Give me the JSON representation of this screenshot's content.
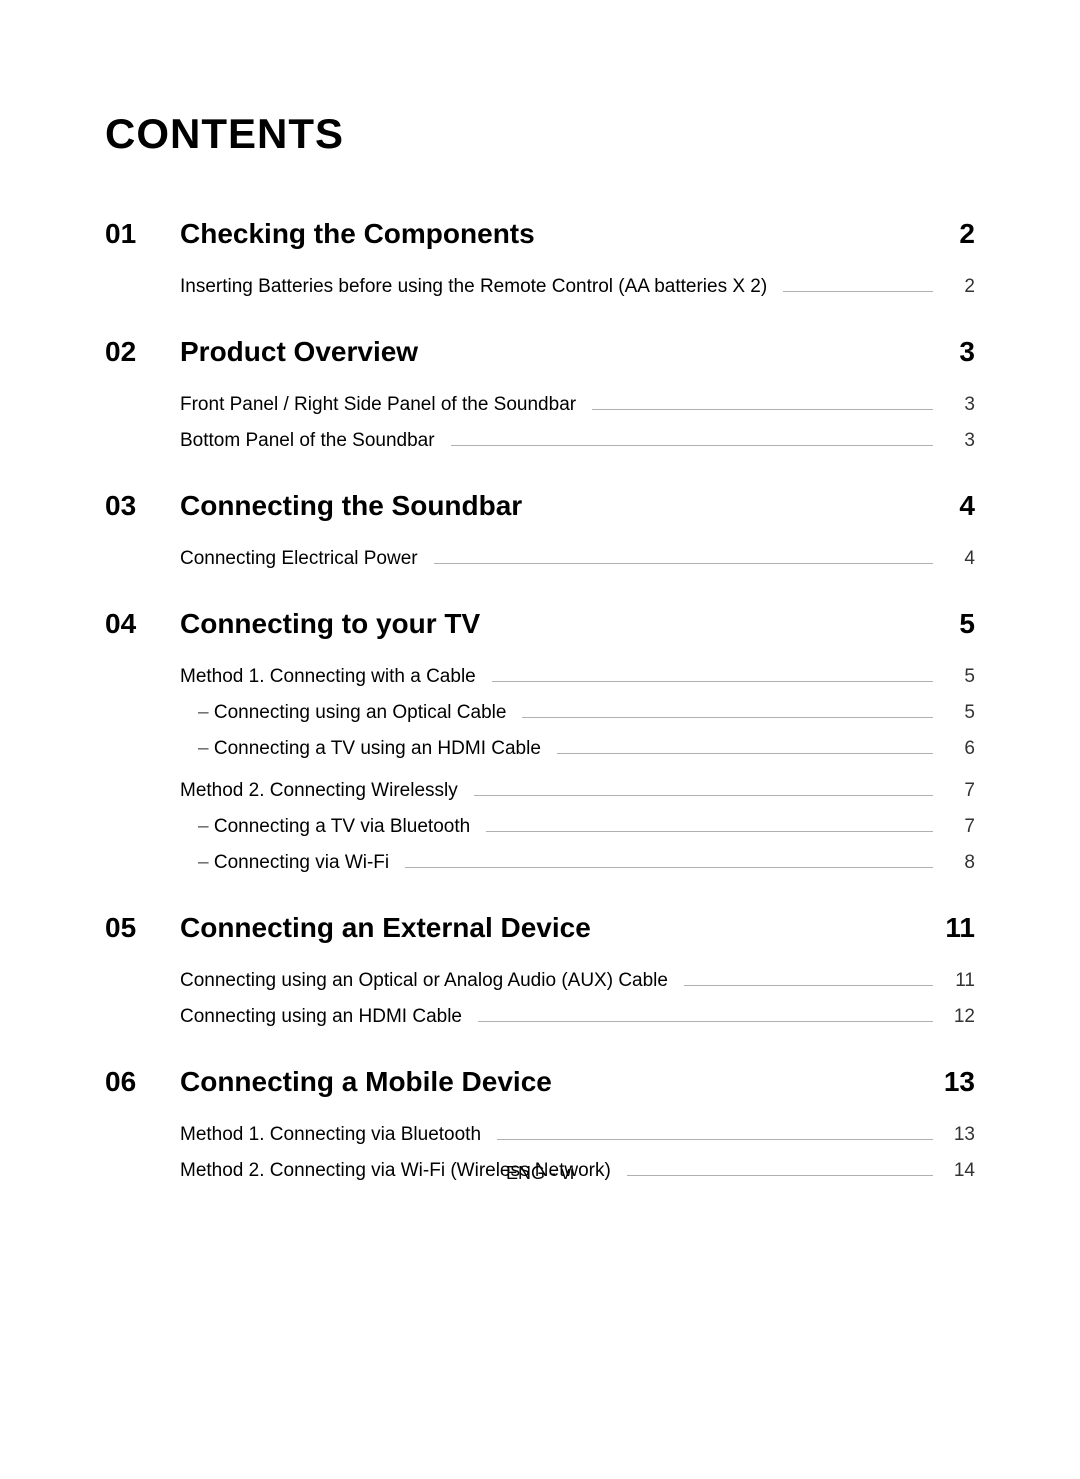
{
  "title": "CONTENTS",
  "footer": "ENG - vi",
  "sections": [
    {
      "num": "01",
      "title": "Checking the Components",
      "page": "2",
      "groups": [
        [
          {
            "title": "Inserting Batteries before using the Remote Control (AA batteries X 2)",
            "page": "2",
            "indent": false
          }
        ]
      ]
    },
    {
      "num": "02",
      "title": "Product Overview",
      "page": "3",
      "groups": [
        [
          {
            "title": "Front Panel / Right Side Panel of the Soundbar",
            "page": "3",
            "indent": false
          },
          {
            "title": "Bottom Panel of the Soundbar",
            "page": "3",
            "indent": false
          }
        ]
      ]
    },
    {
      "num": "03",
      "title": "Connecting the Soundbar",
      "page": "4",
      "groups": [
        [
          {
            "title": "Connecting Electrical Power",
            "page": "4",
            "indent": false
          }
        ]
      ]
    },
    {
      "num": "04",
      "title": "Connecting to your TV",
      "page": "5",
      "groups": [
        [
          {
            "title": "Method 1. Connecting with a Cable",
            "page": "5",
            "indent": false
          },
          {
            "title": "Connecting using an Optical Cable",
            "page": "5",
            "indent": true
          },
          {
            "title": "Connecting a TV using an HDMI Cable",
            "page": "6",
            "indent": true
          }
        ],
        [
          {
            "title": "Method 2. Connecting Wirelessly",
            "page": "7",
            "indent": false
          },
          {
            "title": "Connecting a TV via Bluetooth",
            "page": "7",
            "indent": true
          },
          {
            "title": "Connecting via Wi-Fi",
            "page": "8",
            "indent": true
          }
        ]
      ]
    },
    {
      "num": "05",
      "title": "Connecting an External Device",
      "page": "11",
      "groups": [
        [
          {
            "title": "Connecting using an Optical or Analog Audio (AUX) Cable",
            "page": "11",
            "indent": false
          },
          {
            "title": "Connecting using an HDMI Cable",
            "page": "12",
            "indent": false
          }
        ]
      ]
    },
    {
      "num": "06",
      "title": "Connecting a Mobile Device",
      "page": "13",
      "groups": [
        [
          {
            "title": "Method 1. Connecting via Bluetooth",
            "page": "13",
            "indent": false
          },
          {
            "title": "Method 2. Connecting via Wi-Fi (Wireless Network)",
            "page": "14",
            "indent": false
          }
        ]
      ]
    }
  ]
}
